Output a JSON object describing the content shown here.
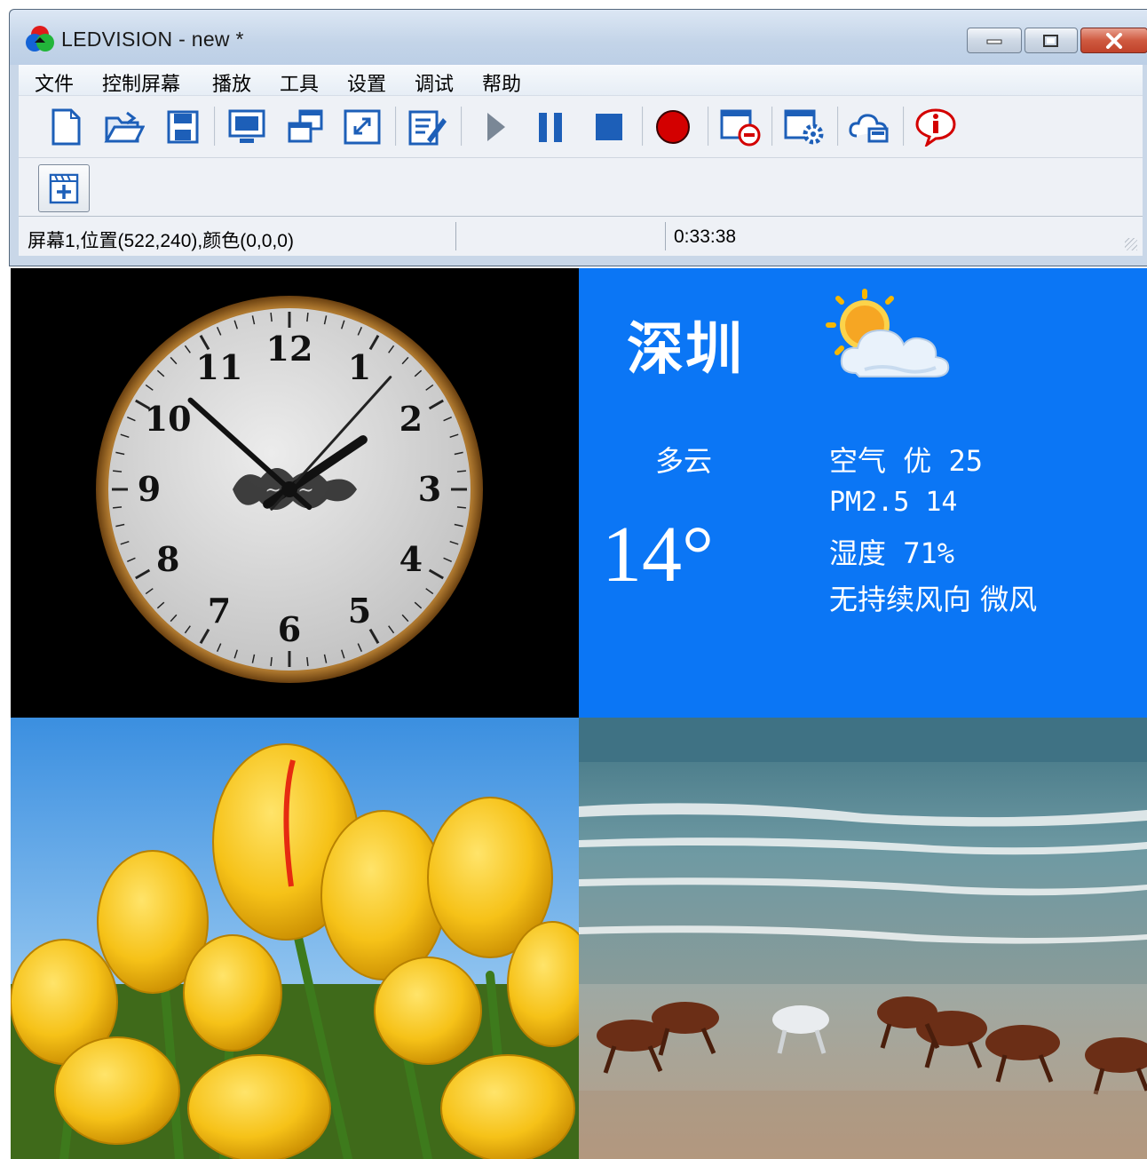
{
  "window": {
    "title": "LEDVISION - new *"
  },
  "menu": [
    "文件",
    "控制屏幕",
    "播放",
    "工具",
    "设置",
    "调试",
    "帮助"
  ],
  "toolbar": {
    "buttons": [
      "new-file-icon",
      "open-folder-icon",
      "save-icon",
      "screen-icon",
      "windows-icon",
      "fullscreen-icon",
      "edit-icon",
      "play-icon",
      "pause-icon",
      "stop-icon",
      "record-icon",
      "remove-screen-icon",
      "screen-settings-icon",
      "cloud-icon",
      "info-icon"
    ]
  },
  "toolbar2": {
    "add_program": "add-program-icon"
  },
  "status": {
    "position": "屏幕1,位置(522,240),颜色(0,0,0)",
    "time": "0:33:38"
  },
  "clock": {
    "numerals": [
      "12",
      "1",
      "2",
      "3",
      "4",
      "5",
      "6",
      "7",
      "8",
      "9",
      "10",
      "11"
    ],
    "hour": 1,
    "minute": 52,
    "second": 7
  },
  "weather": {
    "city": "深圳",
    "condition": "多云",
    "temperature": "14°",
    "air": "空气 优 25",
    "pm25": "PM2.5 14",
    "humidity": "湿度 71%",
    "wind": "无持续风向 微风",
    "icon": "partly-cloudy-icon"
  },
  "colors": {
    "weather_bg": "#0b76f5",
    "clock_rim": "#8a5a18",
    "record": "#d30000",
    "toolbar_blue": "#1d5fb8"
  }
}
